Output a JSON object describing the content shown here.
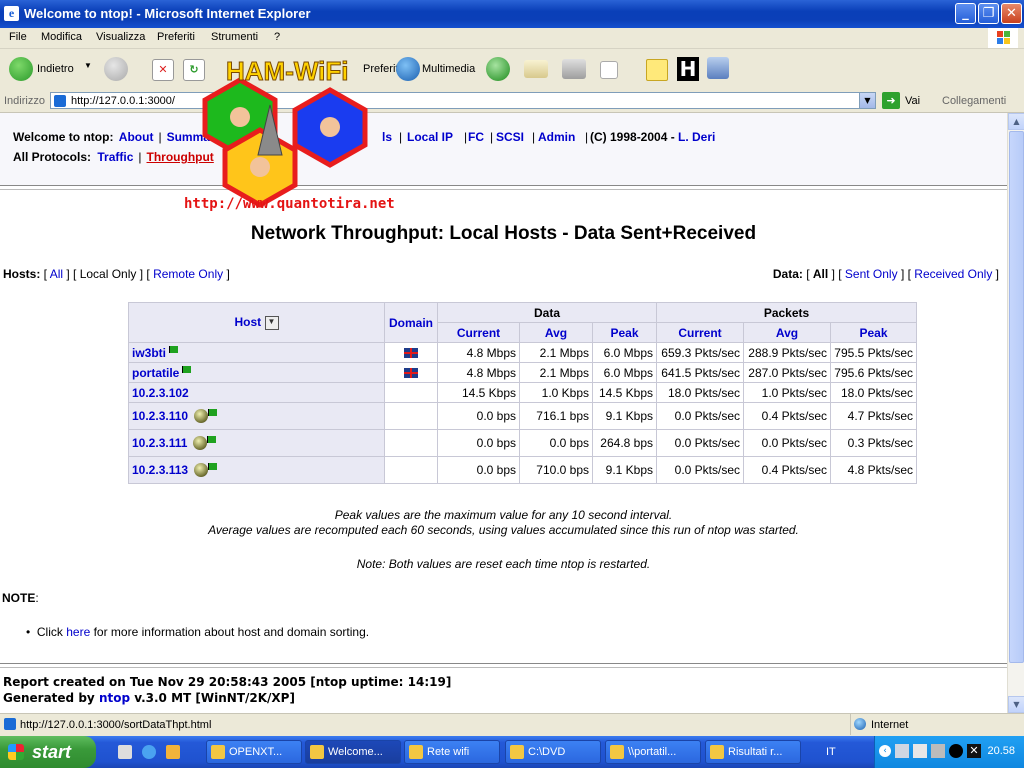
{
  "window": {
    "title": "Welcome to ntop! - Microsoft Internet Explorer"
  },
  "menu": {
    "items": [
      "File",
      "Modifica",
      "Visualizza",
      "Preferiti",
      "Strumenti",
      "?"
    ]
  },
  "toolbar": {
    "back": "Indietro",
    "favorites": "Preferiti",
    "media": "Multimedia"
  },
  "address": {
    "label": "Indirizzo",
    "url": "http://127.0.0.1:3000/",
    "go": "Vai",
    "links": "Collegamenti"
  },
  "nav": {
    "welcome": "Welcome to ntop:",
    "about": "About",
    "summary": "Summary",
    "local_ip": "Local IP",
    "fc": "FC",
    "scsi": "SCSI",
    "admin": "Admin",
    "copyright": "(C) 1998-2004 -",
    "author": "L. Deri",
    "protocols_label": "All Protocols:",
    "traffic": "Traffic",
    "throughput": "Throughput",
    "ls_fragment": "ls"
  },
  "page_title": "Network Throughput: Local Hosts - Data Sent+Received",
  "hosts_filter": {
    "label": "Hosts:",
    "all": "All",
    "local": "Local Only",
    "remote": "Remote Only"
  },
  "data_filter": {
    "label": "Data:",
    "all": "All",
    "sent": "Sent Only",
    "received": "Received Only"
  },
  "table": {
    "col_host": "Host",
    "col_domain": "Domain",
    "col_data": "Data",
    "col_packets": "Packets",
    "sub_current": "Current",
    "sub_avg": "Avg",
    "sub_peak": "Peak",
    "rows": [
      {
        "host": "iw3bti",
        "domain_flag": "uk",
        "d_cur": "4.8 Mbps",
        "d_avg": "2.1 Mbps",
        "d_peak": "6.0 Mbps",
        "p_cur": "659.3 Pkts/sec",
        "p_avg": "288.9 Pkts/sec",
        "p_peak": "795.5 Pkts/sec"
      },
      {
        "host": "portatile",
        "domain_flag": "uk",
        "d_cur": "4.8 Mbps",
        "d_avg": "2.1 Mbps",
        "d_peak": "6.0 Mbps",
        "p_cur": "641.5 Pkts/sec",
        "p_avg": "287.0 Pkts/sec",
        "p_peak": "795.6 Pkts/sec"
      },
      {
        "host": "10.2.3.102",
        "domain_flag": "",
        "d_cur": "14.5 Kbps",
        "d_avg": "1.0 Kbps",
        "d_peak": "14.5 Kbps",
        "p_cur": "18.0 Pkts/sec",
        "p_avg": "1.0 Pkts/sec",
        "p_peak": "18.0 Pkts/sec"
      },
      {
        "host": "10.2.3.110",
        "domain_flag": "",
        "d_cur": "0.0 bps",
        "d_avg": "716.1 bps",
        "d_peak": "9.1 Kbps",
        "p_cur": "0.0 Pkts/sec",
        "p_avg": "0.4 Pkts/sec",
        "p_peak": "4.7 Pkts/sec"
      },
      {
        "host": "10.2.3.111",
        "domain_flag": "",
        "d_cur": "0.0 bps",
        "d_avg": "0.0 bps",
        "d_peak": "264.8 bps",
        "p_cur": "0.0 Pkts/sec",
        "p_avg": "0.0 Pkts/sec",
        "p_peak": "0.3 Pkts/sec"
      },
      {
        "host": "10.2.3.113",
        "domain_flag": "",
        "d_cur": "0.0 bps",
        "d_avg": "710.0 bps",
        "d_peak": "9.1 Kbps",
        "p_cur": "0.0 Pkts/sec",
        "p_avg": "0.4 Pkts/sec",
        "p_peak": "4.8 Pkts/sec"
      }
    ]
  },
  "notes": {
    "line1": "Peak values are the maximum value for any 10 second interval.",
    "line2": "Average values are recomputed each 60 seconds, using values accumulated since this run of ntop was started.",
    "line3": "Note: Both values are reset each time ntop is restarted."
  },
  "note_section": {
    "label": "NOTE",
    "colon": ":",
    "click": "Click",
    "here": "here",
    "rest": "for more information about host and domain sorting."
  },
  "footer": {
    "report": "Report created on Tue Nov 29 20:58:43 2005 [ntop uptime: 14:19]",
    "generated_by": "Generated by",
    "ntop": "ntop",
    "version": "v.3.0 MT [WinNT/2K/XP]"
  },
  "overlay": {
    "brand": "HAM-WiFi",
    "url": "http://www.quantotira.net"
  },
  "status": {
    "url": "http://127.0.0.1:3000/sortDataThpt.html",
    "zone": "Internet"
  },
  "taskbar": {
    "start": "start",
    "tasks": [
      "OPENXT...",
      "Welcome...",
      "Rete wifi",
      "C:\\DVD",
      "\\\\portatil...",
      "Risultati r..."
    ],
    "lang": "IT",
    "clock": "20.58"
  },
  "colors": {
    "link": "#0000cc",
    "active_link": "#cc0000",
    "header_bg": "#e9e9f4",
    "xp_blue": "#2459d8"
  }
}
